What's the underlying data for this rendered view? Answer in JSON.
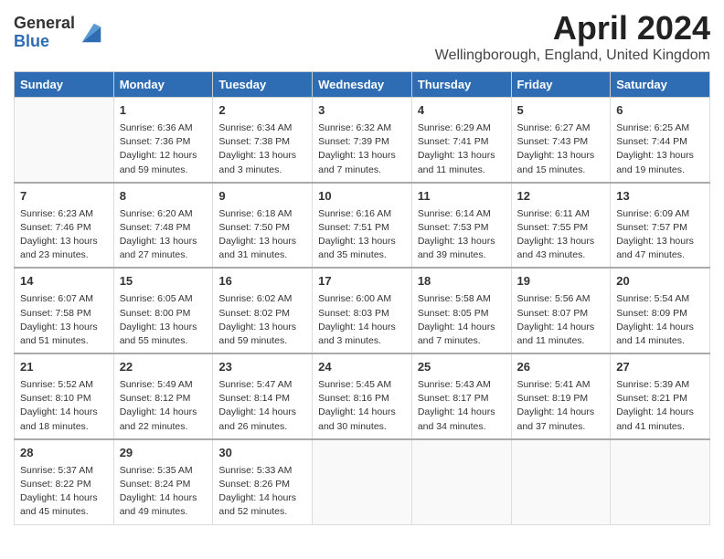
{
  "logo": {
    "general": "General",
    "blue": "Blue"
  },
  "title": "April 2024",
  "location": "Wellingborough, England, United Kingdom",
  "days_of_week": [
    "Sunday",
    "Monday",
    "Tuesday",
    "Wednesday",
    "Thursday",
    "Friday",
    "Saturday"
  ],
  "weeks": [
    [
      {
        "day": "",
        "info": ""
      },
      {
        "day": "1",
        "info": "Sunrise: 6:36 AM\nSunset: 7:36 PM\nDaylight: 12 hours\nand 59 minutes."
      },
      {
        "day": "2",
        "info": "Sunrise: 6:34 AM\nSunset: 7:38 PM\nDaylight: 13 hours\nand 3 minutes."
      },
      {
        "day": "3",
        "info": "Sunrise: 6:32 AM\nSunset: 7:39 PM\nDaylight: 13 hours\nand 7 minutes."
      },
      {
        "day": "4",
        "info": "Sunrise: 6:29 AM\nSunset: 7:41 PM\nDaylight: 13 hours\nand 11 minutes."
      },
      {
        "day": "5",
        "info": "Sunrise: 6:27 AM\nSunset: 7:43 PM\nDaylight: 13 hours\nand 15 minutes."
      },
      {
        "day": "6",
        "info": "Sunrise: 6:25 AM\nSunset: 7:44 PM\nDaylight: 13 hours\nand 19 minutes."
      }
    ],
    [
      {
        "day": "7",
        "info": "Sunrise: 6:23 AM\nSunset: 7:46 PM\nDaylight: 13 hours\nand 23 minutes."
      },
      {
        "day": "8",
        "info": "Sunrise: 6:20 AM\nSunset: 7:48 PM\nDaylight: 13 hours\nand 27 minutes."
      },
      {
        "day": "9",
        "info": "Sunrise: 6:18 AM\nSunset: 7:50 PM\nDaylight: 13 hours\nand 31 minutes."
      },
      {
        "day": "10",
        "info": "Sunrise: 6:16 AM\nSunset: 7:51 PM\nDaylight: 13 hours\nand 35 minutes."
      },
      {
        "day": "11",
        "info": "Sunrise: 6:14 AM\nSunset: 7:53 PM\nDaylight: 13 hours\nand 39 minutes."
      },
      {
        "day": "12",
        "info": "Sunrise: 6:11 AM\nSunset: 7:55 PM\nDaylight: 13 hours\nand 43 minutes."
      },
      {
        "day": "13",
        "info": "Sunrise: 6:09 AM\nSunset: 7:57 PM\nDaylight: 13 hours\nand 47 minutes."
      }
    ],
    [
      {
        "day": "14",
        "info": "Sunrise: 6:07 AM\nSunset: 7:58 PM\nDaylight: 13 hours\nand 51 minutes."
      },
      {
        "day": "15",
        "info": "Sunrise: 6:05 AM\nSunset: 8:00 PM\nDaylight: 13 hours\nand 55 minutes."
      },
      {
        "day": "16",
        "info": "Sunrise: 6:02 AM\nSunset: 8:02 PM\nDaylight: 13 hours\nand 59 minutes."
      },
      {
        "day": "17",
        "info": "Sunrise: 6:00 AM\nSunset: 8:03 PM\nDaylight: 14 hours\nand 3 minutes."
      },
      {
        "day": "18",
        "info": "Sunrise: 5:58 AM\nSunset: 8:05 PM\nDaylight: 14 hours\nand 7 minutes."
      },
      {
        "day": "19",
        "info": "Sunrise: 5:56 AM\nSunset: 8:07 PM\nDaylight: 14 hours\nand 11 minutes."
      },
      {
        "day": "20",
        "info": "Sunrise: 5:54 AM\nSunset: 8:09 PM\nDaylight: 14 hours\nand 14 minutes."
      }
    ],
    [
      {
        "day": "21",
        "info": "Sunrise: 5:52 AM\nSunset: 8:10 PM\nDaylight: 14 hours\nand 18 minutes."
      },
      {
        "day": "22",
        "info": "Sunrise: 5:49 AM\nSunset: 8:12 PM\nDaylight: 14 hours\nand 22 minutes."
      },
      {
        "day": "23",
        "info": "Sunrise: 5:47 AM\nSunset: 8:14 PM\nDaylight: 14 hours\nand 26 minutes."
      },
      {
        "day": "24",
        "info": "Sunrise: 5:45 AM\nSunset: 8:16 PM\nDaylight: 14 hours\nand 30 minutes."
      },
      {
        "day": "25",
        "info": "Sunrise: 5:43 AM\nSunset: 8:17 PM\nDaylight: 14 hours\nand 34 minutes."
      },
      {
        "day": "26",
        "info": "Sunrise: 5:41 AM\nSunset: 8:19 PM\nDaylight: 14 hours\nand 37 minutes."
      },
      {
        "day": "27",
        "info": "Sunrise: 5:39 AM\nSunset: 8:21 PM\nDaylight: 14 hours\nand 41 minutes."
      }
    ],
    [
      {
        "day": "28",
        "info": "Sunrise: 5:37 AM\nSunset: 8:22 PM\nDaylight: 14 hours\nand 45 minutes."
      },
      {
        "day": "29",
        "info": "Sunrise: 5:35 AM\nSunset: 8:24 PM\nDaylight: 14 hours\nand 49 minutes."
      },
      {
        "day": "30",
        "info": "Sunrise: 5:33 AM\nSunset: 8:26 PM\nDaylight: 14 hours\nand 52 minutes."
      },
      {
        "day": "",
        "info": ""
      },
      {
        "day": "",
        "info": ""
      },
      {
        "day": "",
        "info": ""
      },
      {
        "day": "",
        "info": ""
      }
    ]
  ]
}
